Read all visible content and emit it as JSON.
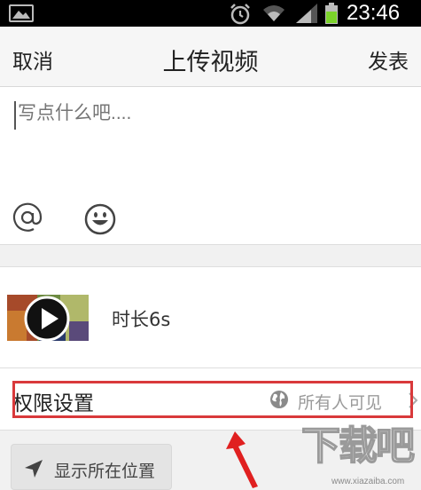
{
  "status_bar": {
    "time": "23:46",
    "icons": [
      "image-icon",
      "alarm-icon",
      "wifi-icon",
      "signal-icon",
      "battery-icon"
    ],
    "battery_color": "#7bd32a"
  },
  "header": {
    "cancel_label": "取消",
    "title": "上传视频",
    "publish_label": "发表"
  },
  "compose": {
    "placeholder": "写点什么吧....",
    "icons": [
      "at-icon",
      "emoji-icon"
    ]
  },
  "video": {
    "duration_label": "时长6s"
  },
  "permission": {
    "label": "权限设置",
    "value": "所有人可见",
    "highlight_color": "#d9393b"
  },
  "location": {
    "label": "显示所在位置"
  },
  "watermark": {
    "text": "下载吧",
    "url": "www.xiazaiba.com"
  }
}
